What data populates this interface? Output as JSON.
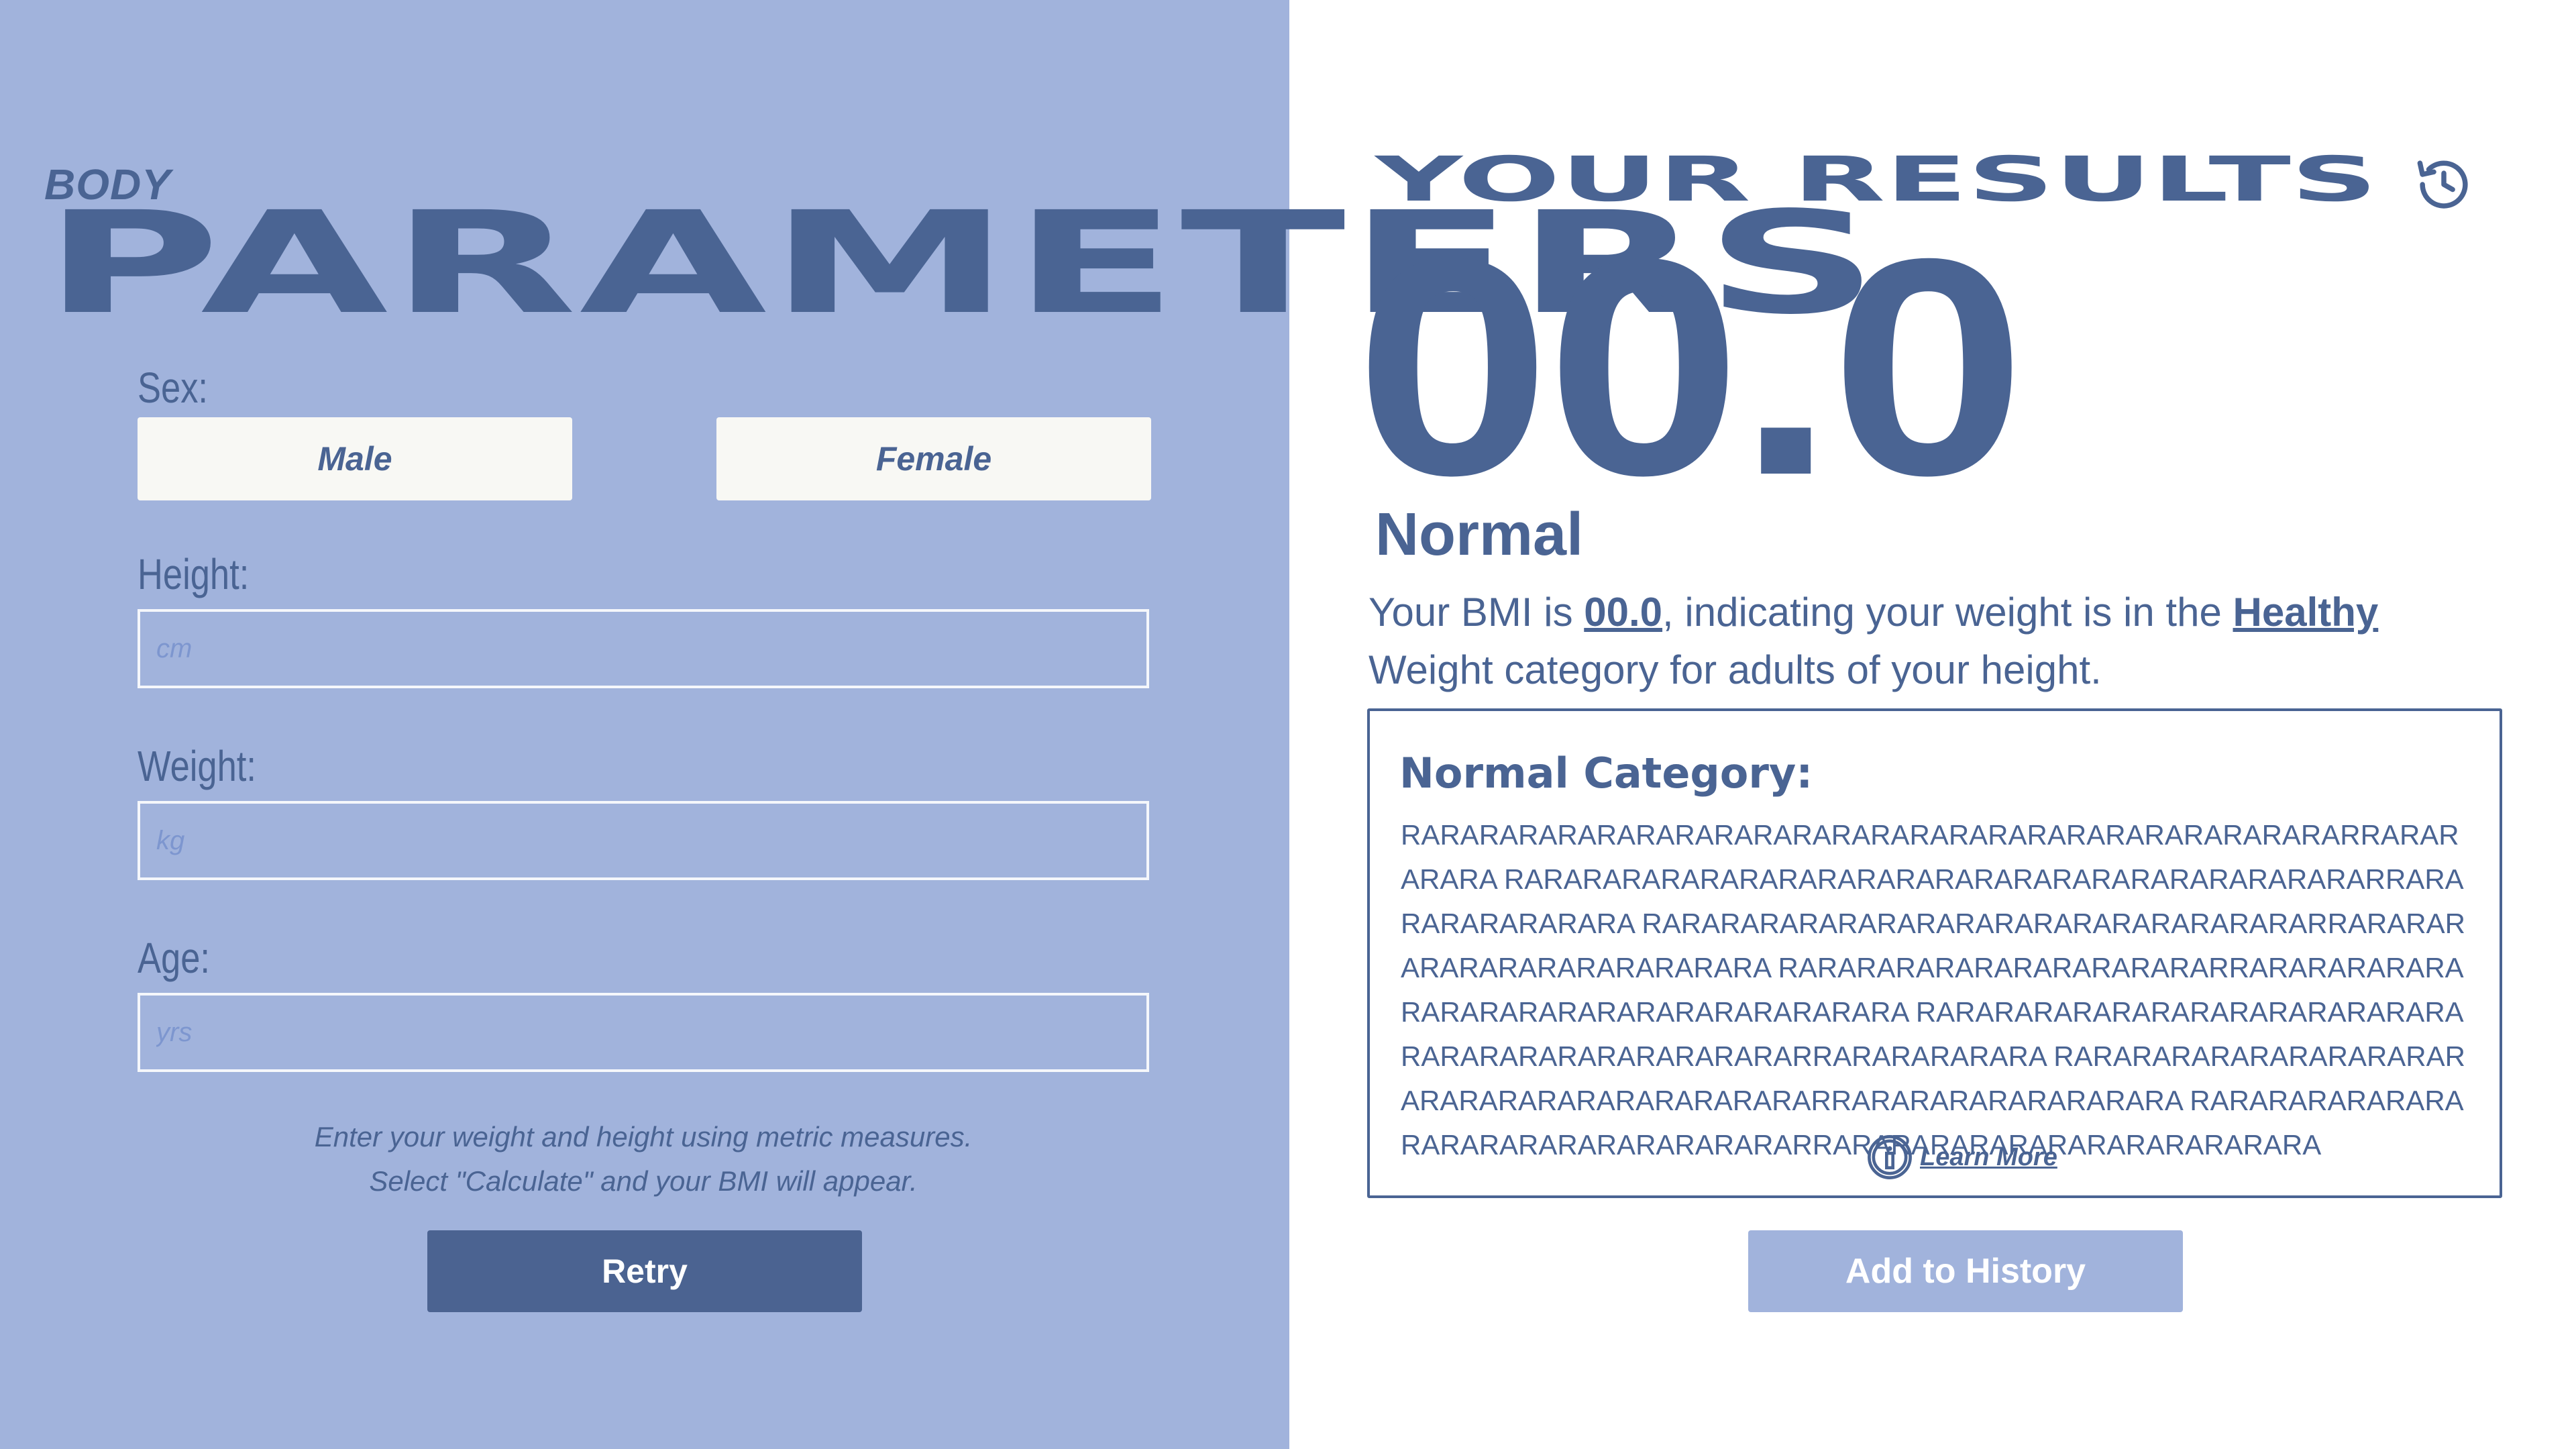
{
  "theme": {
    "primary": "#4a6493",
    "panel_bg": "#a1b3dc",
    "button_light": "#f8f8f4",
    "white": "#ffffff"
  },
  "parameters": {
    "eyebrow": "BODY",
    "title": "PARAMETERS",
    "sex": {
      "label": "Sex:",
      "options": [
        "Male",
        "Female"
      ]
    },
    "height": {
      "label": "Height:",
      "value": "",
      "placeholder": "cm"
    },
    "weight": {
      "label": "Weight:",
      "value": "",
      "placeholder": "kg"
    },
    "age": {
      "label": "Age:",
      "value": "",
      "placeholder": "yrs"
    },
    "hint_lines": [
      "Enter your weight and height using metric measures.",
      "Select \"Calculate\" and your BMI will appear."
    ],
    "retry_label": "Retry"
  },
  "results": {
    "title": "YOUR RESULTS",
    "history_icon": "history-icon",
    "bmi_value": "00.0",
    "category": "Normal",
    "summary": {
      "prefix": "Your BMI is ",
      "bmi": "00.0",
      "middle": ", indicating your weight is in the ",
      "category_link": "Healthy",
      "suffix": " Weight category for adults of your height."
    },
    "info_box": {
      "heading": "Normal Category:",
      "body": "RARARARARARARARARARARARARARARARARARARARARARARARARRARARARARA RARARARARARARARARARARARARARARARARARARARARARARRARARARARARARARA RARARARARARARARARARARARARARARARARARRARARARARARARARARARARARARA RARARARARARARARARARARARRARARARARARARARARARARARARARARARARARARA RARARARARARARARARARARARARARARARARARARARARARARARARRARARARARARA RARARARARARARARARARARARARARARARARARARARARARRARARARARARARARARA RARARARARARARARARARARARARARARARARARRARARARARARARARARARARARARA",
      "learn_more": "Learn More",
      "learn_more_icon": "info-icon"
    },
    "add_history_label": "Add to History"
  }
}
